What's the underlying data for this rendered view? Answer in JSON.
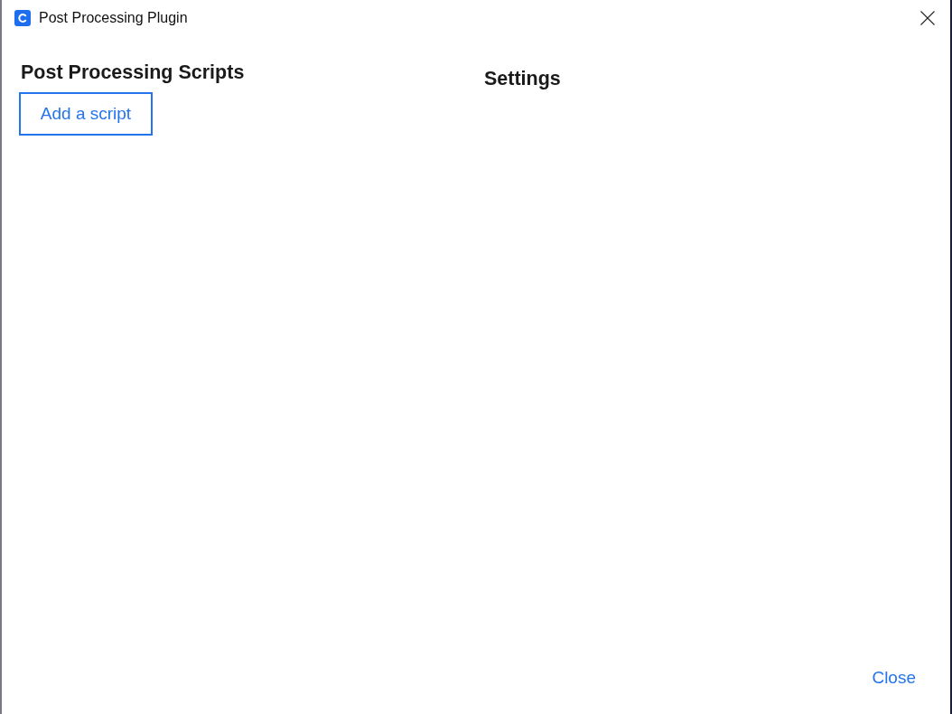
{
  "window": {
    "title": "Post Processing Plugin"
  },
  "scripts_panel": {
    "heading": "Post Processing Scripts",
    "add_button": "Add a script"
  },
  "settings_panel": {
    "heading": "Settings"
  },
  "footer": {
    "close_button": "Close"
  }
}
